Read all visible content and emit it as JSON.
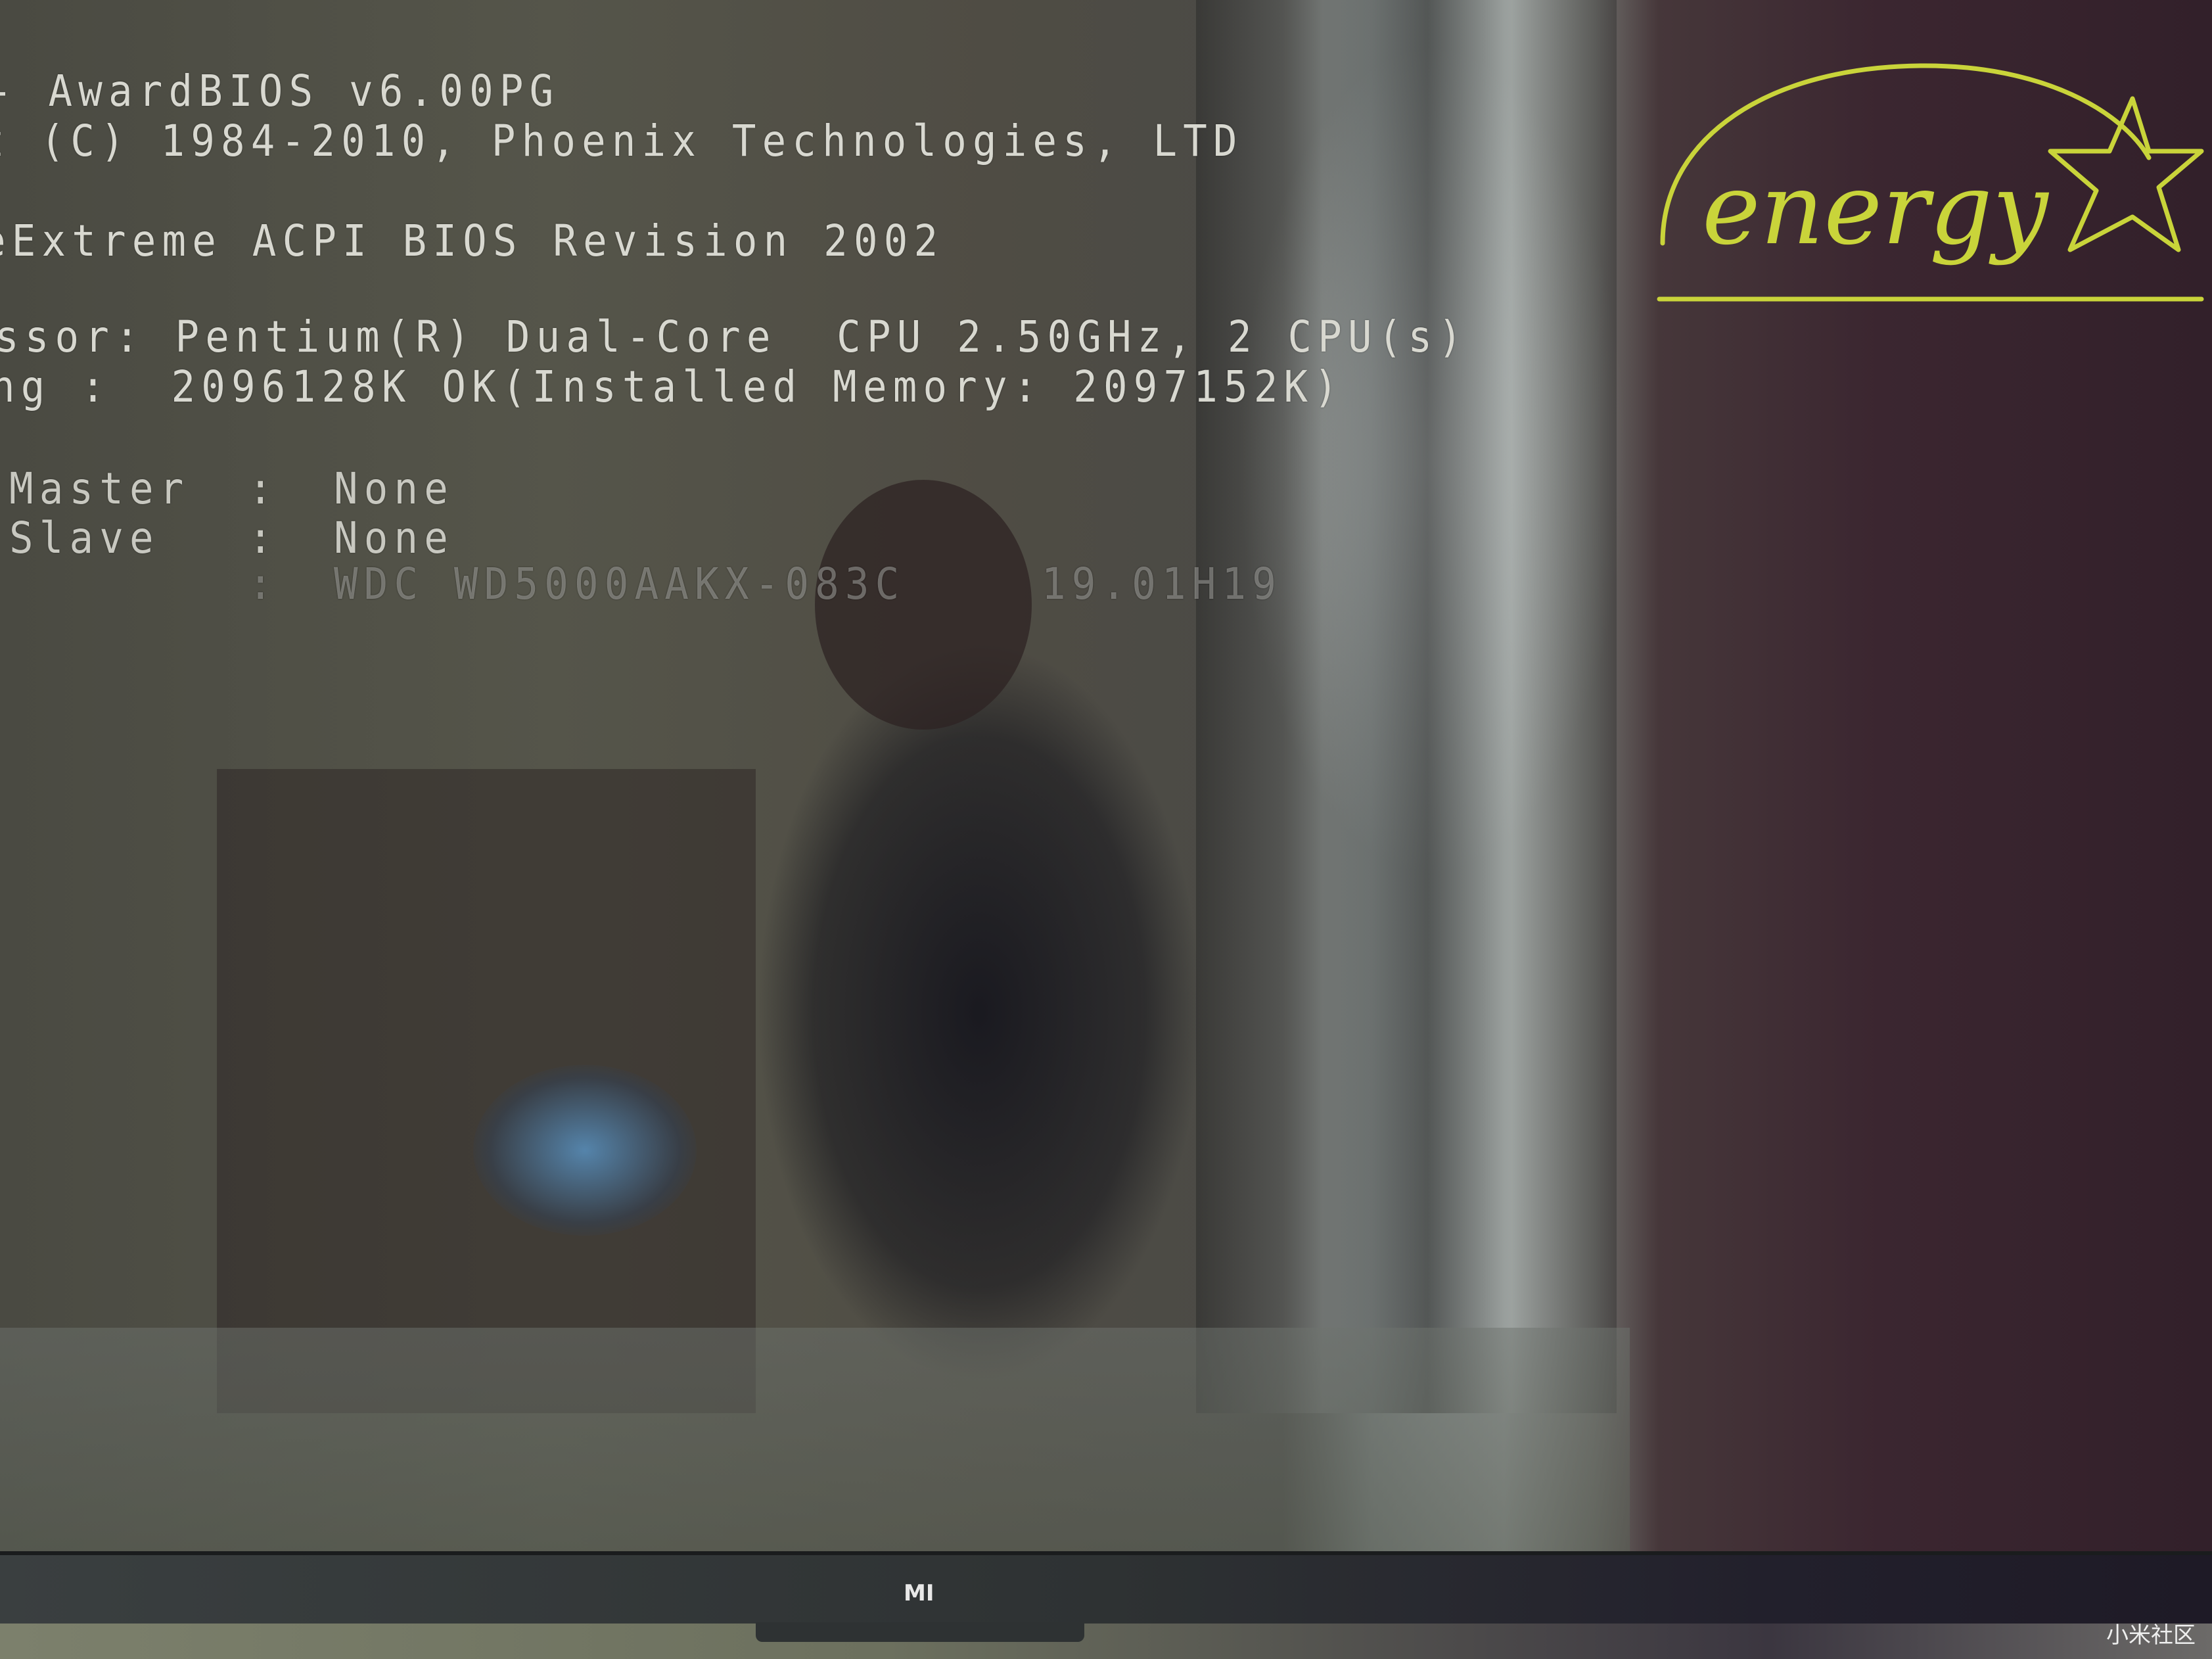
{
  "bios": {
    "lines": [
      "- AwardBIOS v6.00PG",
      "t (C) 1984-2010, Phoenix Technologies, LTD",
      "eExtreme ACPI BIOS Revision 2002",
      "ssor: Pentium(R) Dual-Core  CPU 2.50GHz, 2 CPU(s)",
      "ng :  2096128K OK(Installed Memory: 2097152K)"
    ],
    "drives": [
      {
        "label": "Master",
        "sep": ":",
        "value": "None"
      },
      {
        "label": "Slave",
        "sep": ":",
        "value": "None"
      },
      {
        "label": "",
        "sep": ":",
        "value": "WDC WD5000AAKX-083C",
        "value2": "19.01H19"
      }
    ]
  },
  "energy_logo": {
    "text": "energy",
    "color": "#c9d43a"
  },
  "tv": {
    "brand": "MI"
  },
  "watermark": "小米社区"
}
